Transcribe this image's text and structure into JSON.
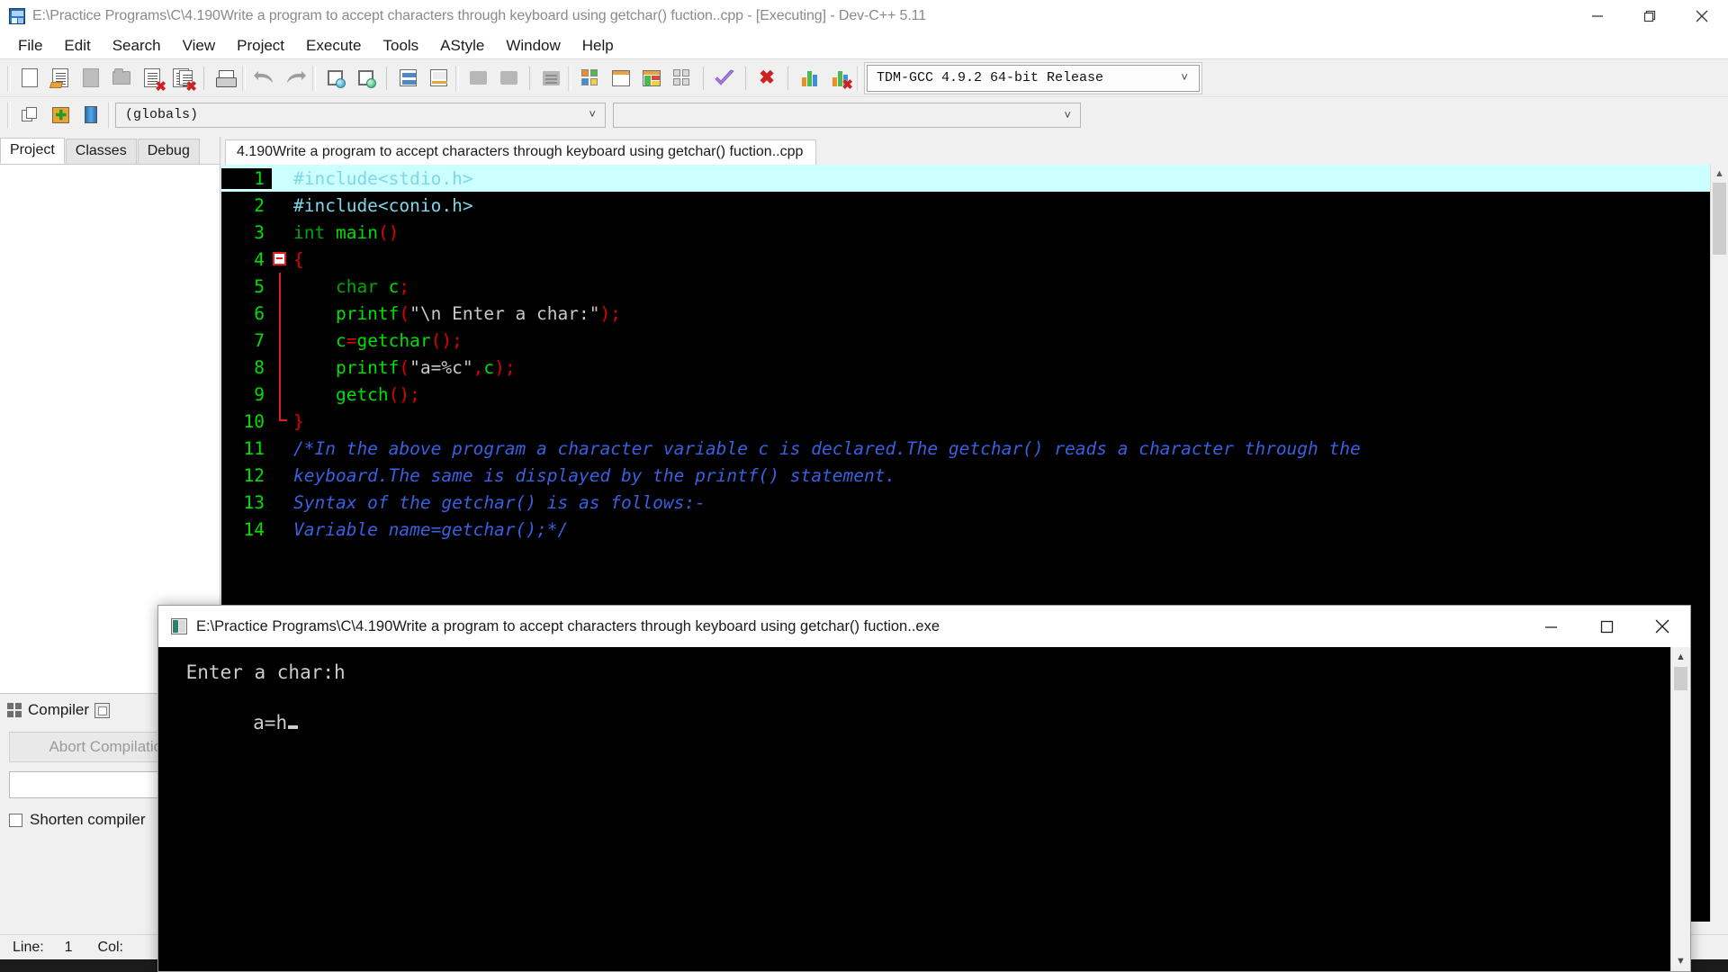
{
  "window": {
    "title": "E:\\Practice Programs\\C\\4.190Write a program to accept characters through keyboard using getchar() fuction..cpp - [Executing] - Dev-C++ 5.11",
    "minimize_label": "Minimize",
    "maximize_label": "Restore",
    "close_label": "Close"
  },
  "menu": {
    "items": [
      {
        "label": "File"
      },
      {
        "label": "Edit"
      },
      {
        "label": "Search"
      },
      {
        "label": "View"
      },
      {
        "label": "Project"
      },
      {
        "label": "Execute"
      },
      {
        "label": "Tools"
      },
      {
        "label": "AStyle"
      },
      {
        "label": "Window"
      },
      {
        "label": "Help"
      }
    ]
  },
  "toolbar": {
    "buttons": [
      {
        "name": "new-file",
        "tooltip": "New file"
      },
      {
        "name": "open-file",
        "tooltip": "Open"
      },
      {
        "name": "save-file",
        "tooltip": "Save"
      },
      {
        "name": "save-all",
        "tooltip": "Save all"
      },
      {
        "name": "close-file",
        "tooltip": "Close"
      },
      {
        "name": "close-all",
        "tooltip": "Close all"
      },
      {
        "name": "print",
        "tooltip": "Print"
      },
      {
        "name": "undo",
        "tooltip": "Undo"
      },
      {
        "name": "redo",
        "tooltip": "Redo"
      },
      {
        "name": "find",
        "tooltip": "Find"
      },
      {
        "name": "replace",
        "tooltip": "Replace"
      },
      {
        "name": "goto-line",
        "tooltip": "Goto line"
      },
      {
        "name": "goto-function",
        "tooltip": "Goto function"
      },
      {
        "name": "back",
        "tooltip": "Back"
      },
      {
        "name": "forward",
        "tooltip": "Forward"
      },
      {
        "name": "todo-list",
        "tooltip": "TODO list"
      },
      {
        "name": "compile",
        "tooltip": "Compile"
      },
      {
        "name": "run",
        "tooltip": "Run"
      },
      {
        "name": "compile-and-run",
        "tooltip": "Compile & Run"
      },
      {
        "name": "rebuild-all",
        "tooltip": "Rebuild all"
      },
      {
        "name": "syntax-check",
        "tooltip": "Syntax check"
      },
      {
        "name": "stop-execution",
        "tooltip": "Stop execution"
      },
      {
        "name": "profile",
        "tooltip": "Profile analysis"
      },
      {
        "name": "delete-profile",
        "tooltip": "Delete profile"
      }
    ],
    "compiler_set": {
      "value": "TDM-GCC 4.9.2 64-bit Release"
    }
  },
  "toolbar2": {
    "buttons": [
      {
        "name": "insert-snippet",
        "tooltip": "Insert"
      },
      {
        "name": "toggle-bookmark",
        "tooltip": "Toggle bookmark"
      },
      {
        "name": "goto-bookmark",
        "tooltip": "Goto bookmark"
      }
    ],
    "scope_combo": {
      "value": "(globals)"
    },
    "member_combo": {
      "value": ""
    }
  },
  "left_panel": {
    "tabs": [
      {
        "label": "Project",
        "active": true
      },
      {
        "label": "Classes",
        "active": false
      },
      {
        "label": "Debug",
        "active": false
      }
    ]
  },
  "bottom_panel": {
    "tabs": [
      {
        "label": "Compiler",
        "icon": "compiler-icon"
      },
      {
        "label": "",
        "icon": "resources-icon"
      }
    ],
    "abort_button": "Abort Compilation",
    "shorten_checkbox": "Shorten compiler",
    "shorten_checked": false
  },
  "editor": {
    "tab_label": "4.190Write a program to accept characters through keyboard using getchar() fuction..cpp",
    "current_line": 1,
    "lines": [
      {
        "n": "1",
        "fold": "none",
        "tokens": [
          {
            "t": "#include<stdio.h>",
            "c": "k-pre"
          }
        ]
      },
      {
        "n": "2",
        "fold": "none",
        "tokens": [
          {
            "t": "#include<conio.h>",
            "c": "k-pre"
          }
        ]
      },
      {
        "n": "3",
        "fold": "none",
        "tokens": [
          {
            "t": "int ",
            "c": "k-key"
          },
          {
            "t": "main",
            "c": "k-id"
          },
          {
            "t": "()",
            "c": "k-sym"
          }
        ]
      },
      {
        "n": "4",
        "fold": "box",
        "tokens": [
          {
            "t": "{",
            "c": "k-sym"
          }
        ]
      },
      {
        "n": "5",
        "fold": "line",
        "tokens": [
          {
            "t": "    char ",
            "c": "k-key"
          },
          {
            "t": "c",
            "c": "k-id"
          },
          {
            "t": ";",
            "c": "k-sym"
          }
        ]
      },
      {
        "n": "6",
        "fold": "line",
        "tokens": [
          {
            "t": "    printf",
            "c": "k-id"
          },
          {
            "t": "(",
            "c": "k-sym"
          },
          {
            "t": "\"\\n Enter a char:\"",
            "c": "k-str"
          },
          {
            "t": ");",
            "c": "k-sym"
          }
        ]
      },
      {
        "n": "7",
        "fold": "line",
        "tokens": [
          {
            "t": "    c",
            "c": "k-id"
          },
          {
            "t": "=",
            "c": "k-sym"
          },
          {
            "t": "getchar",
            "c": "k-id"
          },
          {
            "t": "();",
            "c": "k-sym"
          }
        ]
      },
      {
        "n": "8",
        "fold": "line",
        "tokens": [
          {
            "t": "    printf",
            "c": "k-id"
          },
          {
            "t": "(",
            "c": "k-sym"
          },
          {
            "t": "\"a=%c\"",
            "c": "k-str"
          },
          {
            "t": ",",
            "c": "k-sym"
          },
          {
            "t": "c",
            "c": "k-id"
          },
          {
            "t": ");",
            "c": "k-sym"
          }
        ]
      },
      {
        "n": "9",
        "fold": "line",
        "tokens": [
          {
            "t": "    getch",
            "c": "k-id"
          },
          {
            "t": "();",
            "c": "k-sym"
          }
        ]
      },
      {
        "n": "10",
        "fold": "end",
        "tokens": [
          {
            "t": "}",
            "c": "k-sym"
          }
        ]
      },
      {
        "n": "11",
        "fold": "none",
        "tokens": [
          {
            "t": "/*In the above program a character variable c is declared.The getchar() reads a character through the",
            "c": "k-com"
          }
        ]
      },
      {
        "n": "12",
        "fold": "none",
        "tokens": [
          {
            "t": "keyboard.The same is displayed by the printf() statement.",
            "c": "k-com"
          }
        ]
      },
      {
        "n": "13",
        "fold": "none",
        "tokens": [
          {
            "t": "Syntax of the getchar() is as follows:-",
            "c": "k-com"
          }
        ]
      },
      {
        "n": "14",
        "fold": "none",
        "tokens": [
          {
            "t": "Variable name=getchar();*/",
            "c": "k-com"
          }
        ]
      }
    ]
  },
  "console": {
    "title": "E:\\Practice Programs\\C\\4.190Write a program to accept characters through keyboard using getchar() fuction..exe",
    "output_line_1": " Enter a char:h",
    "output_line_2": "a=h",
    "minimize_label": "Minimize",
    "maximize_label": "Maximize",
    "close_label": "Close"
  },
  "statusbar": {
    "line_label": "Line:",
    "line_value": "1",
    "col_label": "Col:",
    "col_value": ""
  },
  "colors": {
    "editor_bg": "#000000",
    "current_line_bg": "#ccffff",
    "line_number": "#00e000",
    "preprocessor": "#7fd7e6",
    "keyword": "#00a800",
    "identifier": "#00e000",
    "symbol": "#e00000",
    "string": "#c8c8c8",
    "comment": "#3a5fe0",
    "fold_marker": "#e02020",
    "console_bg": "#000000",
    "console_fg": "#cccccc",
    "chrome_bg": "#f0f0f0"
  }
}
